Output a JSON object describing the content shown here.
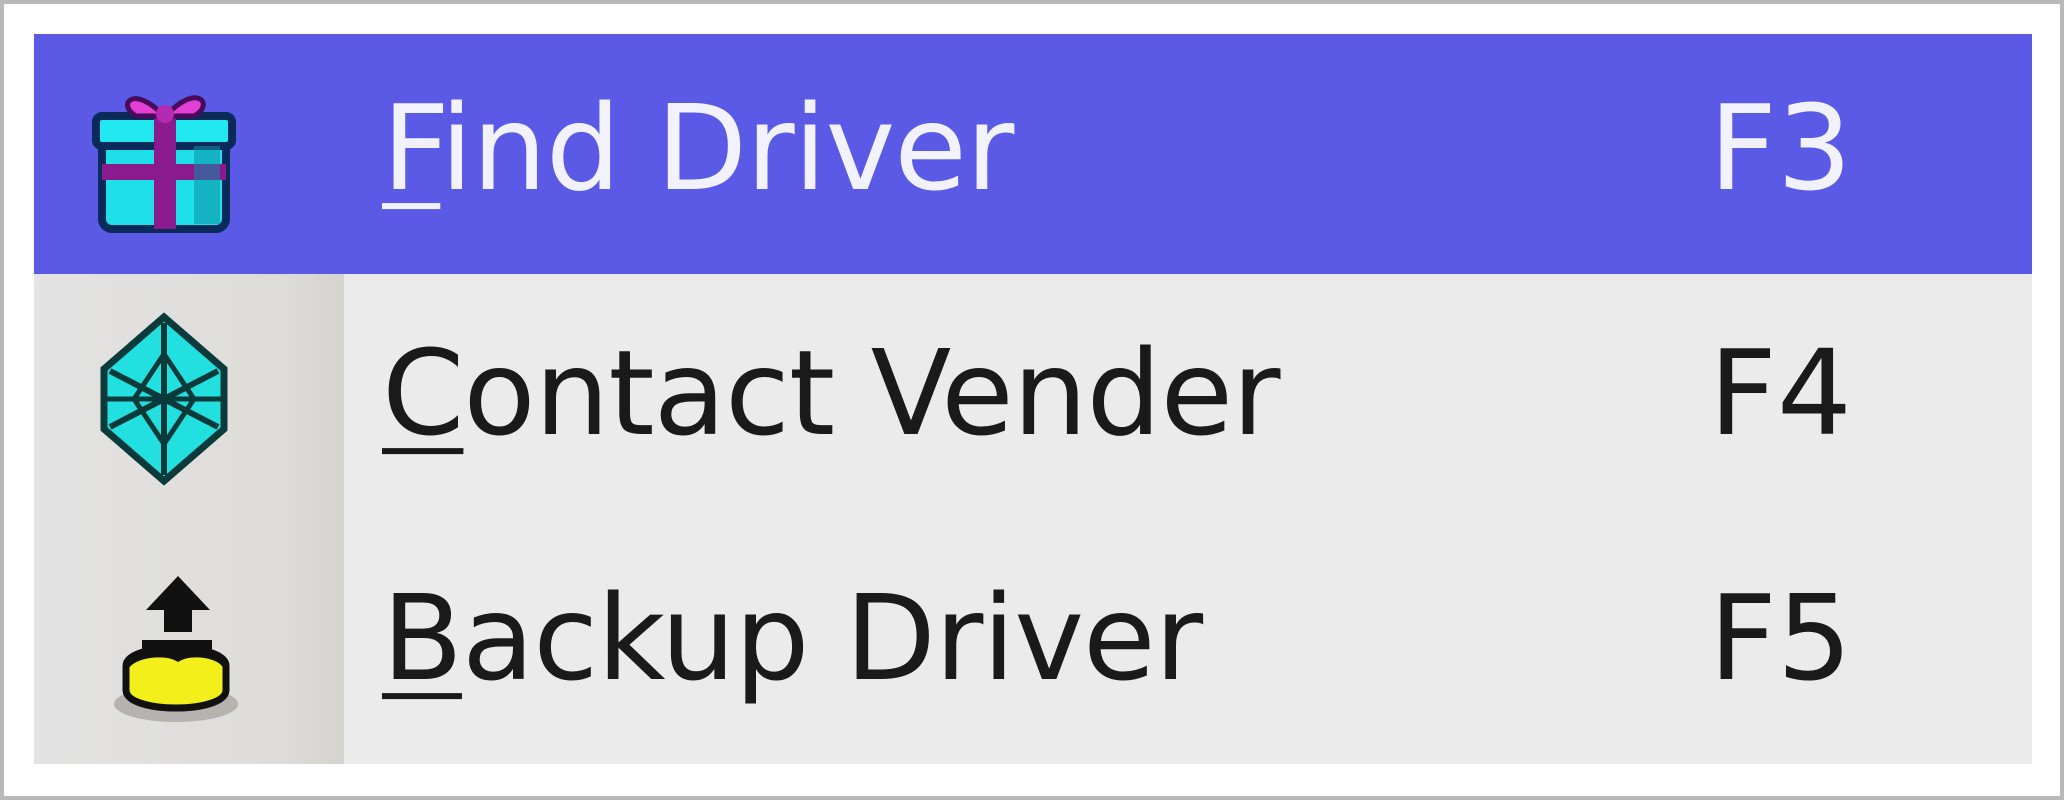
{
  "menu": {
    "items": [
      {
        "label_mnemonic": "F",
        "label_rest": "ind Driver",
        "shortcut": "F3",
        "icon": "gift-box-icon",
        "highlighted": true
      },
      {
        "label_mnemonic": "C",
        "label_rest": "ontact Vender",
        "shortcut": "F4",
        "icon": "snowflake-icon",
        "highlighted": false
      },
      {
        "label_mnemonic": "B",
        "label_rest": "ackup Driver",
        "shortcut": "F5",
        "icon": "backup-upload-icon",
        "highlighted": false
      }
    ]
  },
  "colors": {
    "highlight": "#5a5ae6",
    "menu_background": "#ebebeb",
    "text": "#1a1a1a",
    "highlight_text": "#f2f2ff"
  }
}
